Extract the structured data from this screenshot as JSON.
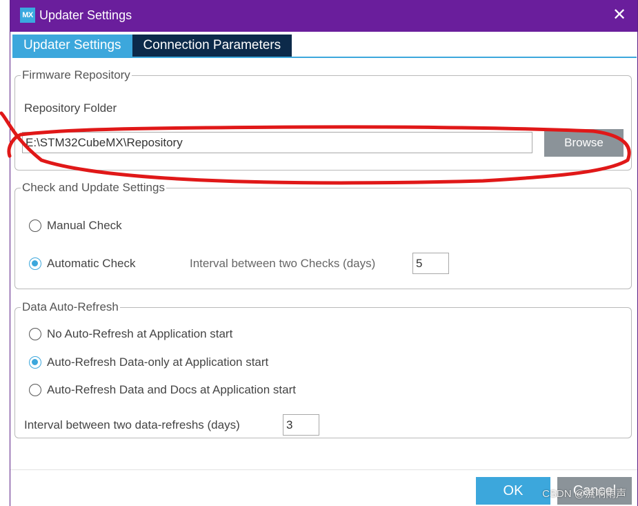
{
  "window": {
    "logo_text": "MX",
    "title": "Updater Settings",
    "close_glyph": "✕",
    "colors": {
      "titlebar": "#6a1e9c",
      "accent": "#3ca7dc",
      "tab_inactive": "#0c2a4a",
      "button_gray": "#8b9399"
    }
  },
  "tabs": [
    {
      "label": "Updater Settings",
      "active": true
    },
    {
      "label": "Connection Parameters",
      "active": false
    }
  ],
  "firmware_repository": {
    "legend": "Firmware Repository",
    "folder_label": "Repository Folder",
    "folder_value": "E:\\STM32CubeMX\\Repository",
    "browse_label": "Browse"
  },
  "check_update": {
    "legend": "Check and Update Settings",
    "manual_label": "Manual Check",
    "manual_checked": false,
    "automatic_label": "Automatic Check",
    "automatic_checked": true,
    "interval_label": "Interval between two Checks (days)",
    "interval_value": "5"
  },
  "auto_refresh": {
    "legend": "Data Auto-Refresh",
    "options": [
      {
        "label": "No Auto-Refresh at Application start",
        "checked": false
      },
      {
        "label": "Auto-Refresh Data-only at Application start",
        "checked": true
      },
      {
        "label": "Auto-Refresh Data and Docs at Application start",
        "checked": false
      }
    ],
    "interval_label": "Interval between two data-refreshs (days)",
    "interval_value": "3"
  },
  "footer": {
    "ok_label": "OK",
    "cancel_label": "Cancel",
    "watermark": "CSDN @流响雨声"
  },
  "annotation": {
    "color": "#e01818"
  }
}
